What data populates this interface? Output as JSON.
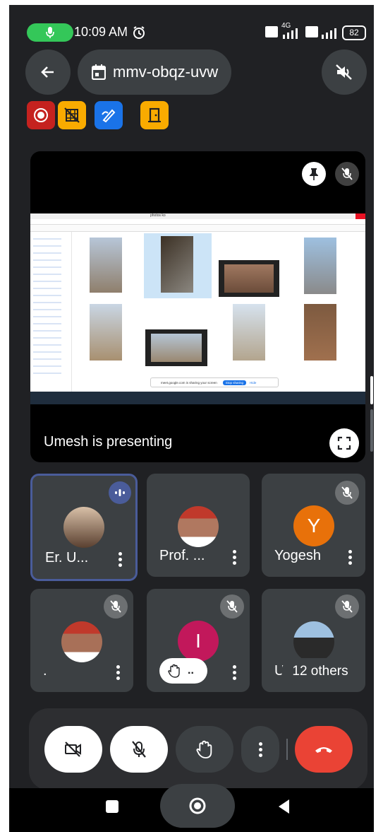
{
  "status": {
    "time": "10:09 AM",
    "battery": "82",
    "network": "4G"
  },
  "header": {
    "meeting_code": "mmv-obqz-uvw"
  },
  "presentation": {
    "label": "Umesh is presenting",
    "shared_window_title": "photos ko",
    "sharing_banner": "meet.google.com is sharing your screen",
    "stop_sharing": "Stop sharing",
    "hide": "Hide"
  },
  "participants": [
    {
      "name": "Er. U...",
      "initial": "",
      "avatar_color": "#ffffff"
    },
    {
      "name": "Prof. ...",
      "initial": "",
      "avatar_color": "#ffffff"
    },
    {
      "name": "Yogesh",
      "initial": "Y",
      "avatar_color": "#e8710a"
    },
    {
      "name": ".",
      "initial": "",
      "avatar_color": "#ffffff"
    },
    {
      "name": "..",
      "initial": "I",
      "avatar_color": "#c2185b"
    },
    {
      "name": "Um",
      "initial": "",
      "avatar_color": "#ffffff"
    }
  ],
  "others_chip": "12 others",
  "colors": {
    "background": "#202124",
    "tile": "#3c4043",
    "end_call": "#ea4335",
    "speaking_border": "#4a5c9a"
  }
}
